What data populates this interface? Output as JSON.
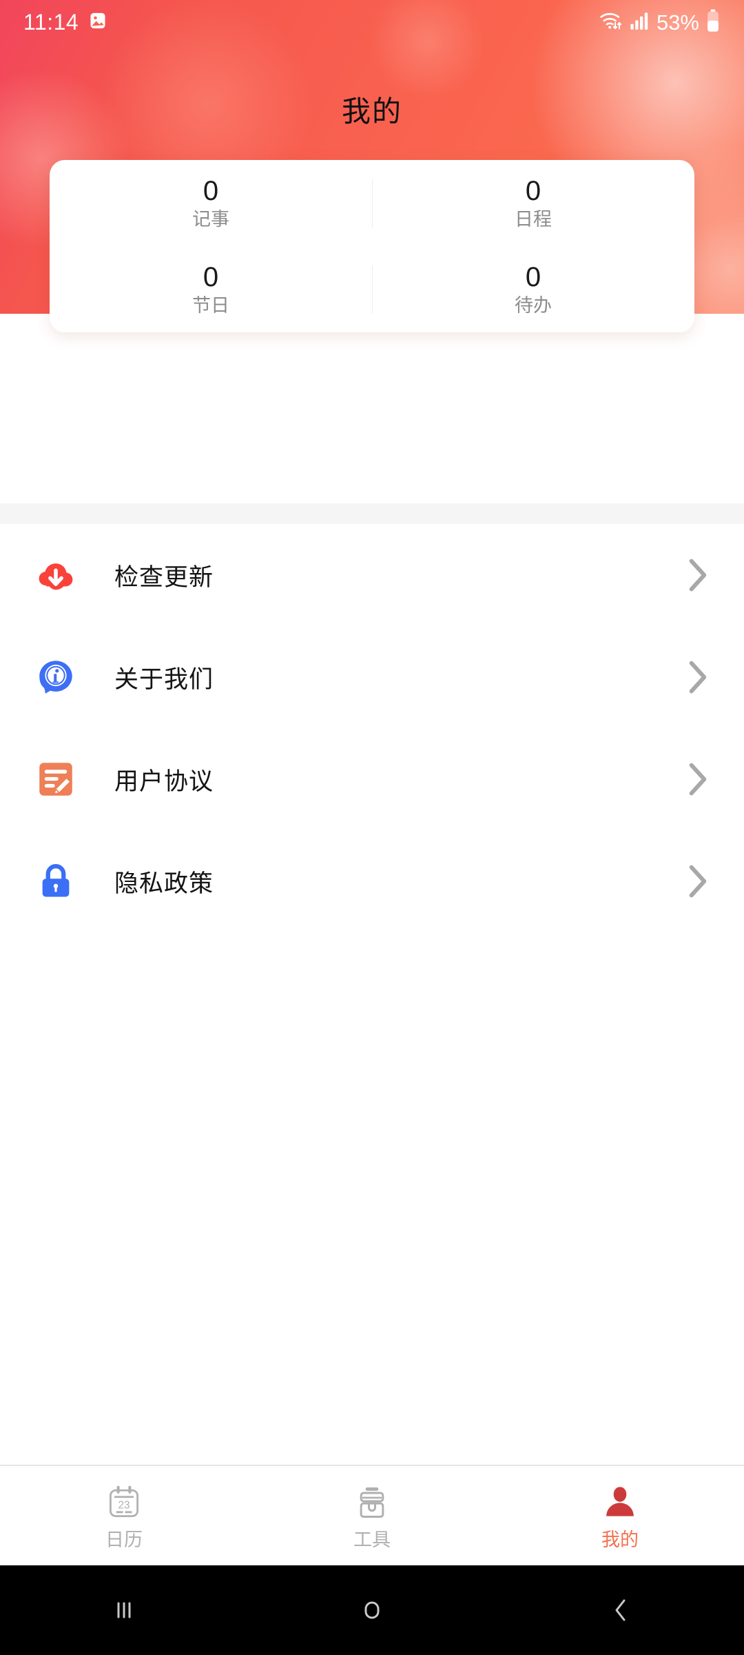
{
  "status_bar": {
    "time": "11:14",
    "image_icon": "image-icon",
    "wifi_icon": "wifi-icon",
    "signal_icon": "cellular-signal-icon",
    "battery_percent": "53%",
    "battery_icon": "battery-icon"
  },
  "header": {
    "title": "我的",
    "gradient_from": "#f2455c",
    "gradient_to": "#fb7d5e"
  },
  "stats": {
    "rows": [
      [
        {
          "value": "0",
          "label": "记事"
        },
        {
          "value": "0",
          "label": "日程"
        }
      ],
      [
        {
          "value": "0",
          "label": "节日"
        },
        {
          "value": "0",
          "label": "待办"
        }
      ]
    ]
  },
  "menu": {
    "items": [
      {
        "label": "检查更新",
        "icon": "cloud-download-icon",
        "color": "#f9423a",
        "chevron": "chevron-right-icon"
      },
      {
        "label": "关于我们",
        "icon": "info-bubble-icon",
        "color": "#3d6ef5",
        "chevron": "chevron-right-icon"
      },
      {
        "label": "用户协议",
        "icon": "document-edit-icon",
        "color": "#ee7f56",
        "chevron": "chevron-right-icon"
      },
      {
        "label": "隐私政策",
        "icon": "lock-icon",
        "color": "#3b6ff5",
        "chevron": "chevron-right-icon"
      }
    ]
  },
  "tabbar": {
    "active_color": "#f4714e",
    "inactive_color": "#b0b0b0",
    "items": [
      {
        "label": "日历",
        "icon": "calendar-icon",
        "day": "23",
        "active": false
      },
      {
        "label": "工具",
        "icon": "toolbox-icon",
        "active": false
      },
      {
        "label": "我的",
        "icon": "person-icon",
        "active": true
      }
    ]
  },
  "navbar": {
    "recents": "recents-icon",
    "home": "home-icon",
    "back": "back-icon"
  }
}
